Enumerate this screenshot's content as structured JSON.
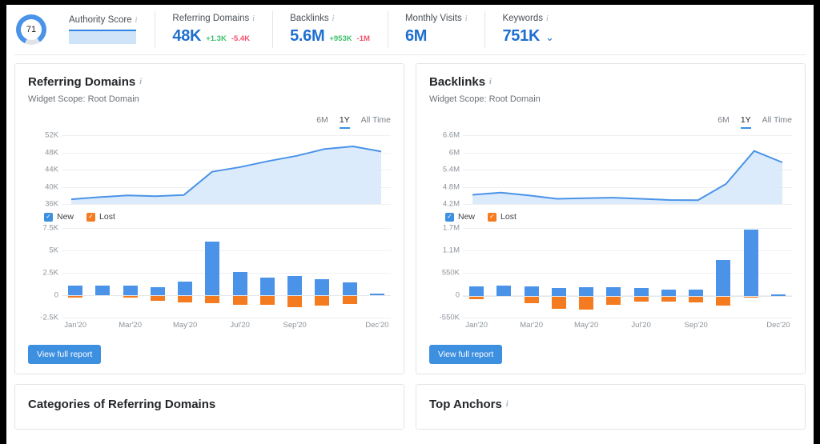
{
  "header": {
    "authority": {
      "label": "Authority Score",
      "score": "71",
      "info_icon": "info-icon"
    },
    "metrics": [
      {
        "label": "Referring Domains",
        "value": "48K",
        "up": "+1.3K",
        "down": "-5.4K"
      },
      {
        "label": "Backlinks",
        "value": "5.6M",
        "up": "+953K",
        "down": "-1M"
      },
      {
        "label": "Monthly Visits",
        "value": "6M",
        "up": "",
        "down": ""
      },
      {
        "label": "Keywords",
        "value": "751K",
        "up": "",
        "down": "",
        "caret": "⌄"
      }
    ]
  },
  "colors": {
    "blue": "#4a93e8",
    "orange": "#f47b20",
    "value_blue": "#1f6fd0",
    "up_green": "#3ec06c",
    "down_red": "#f4516c",
    "area_fill": "#d6e8fb"
  },
  "cards": [
    {
      "title": "Referring Domains",
      "subtitle": "Widget Scope: Root Domain",
      "ranges": [
        "6M",
        "1Y",
        "All Time"
      ],
      "active_range": "1Y",
      "legend": [
        {
          "label": "New",
          "color": "blue",
          "checked": true
        },
        {
          "label": "Lost",
          "color": "orange",
          "checked": true
        }
      ],
      "button": "View full report"
    },
    {
      "title": "Backlinks",
      "subtitle": "Widget Scope: Root Domain",
      "ranges": [
        "6M",
        "1Y",
        "All Time"
      ],
      "active_range": "1Y",
      "legend": [
        {
          "label": "New",
          "color": "blue",
          "checked": true
        },
        {
          "label": "Lost",
          "color": "orange",
          "checked": true
        }
      ],
      "button": "View full report"
    }
  ],
  "bottom_cards": [
    {
      "title": "Categories of Referring Domains",
      "has_info": false
    },
    {
      "title": "Top Anchors",
      "has_info": true
    }
  ],
  "chart_data": [
    {
      "type": "area",
      "title": "Referring Domains",
      "xlabel": "",
      "ylabel": "",
      "categories": [
        "Jan'20",
        "Feb'20",
        "Mar'20",
        "Apr'20",
        "May'20",
        "Jun'20",
        "Jul'20",
        "Aug'20",
        "Sep'20",
        "Oct'20",
        "Nov'20",
        "Dec'20"
      ],
      "tick_labels": [
        "Jan'20",
        "Mar'20",
        "May'20",
        "Jul'20",
        "Sep'20",
        "Dec'20"
      ],
      "yticks": [
        "36K",
        "40K",
        "44K",
        "48K",
        "52K"
      ],
      "ylim": [
        36000,
        52000
      ],
      "values": [
        37100,
        37600,
        38000,
        37800,
        38100,
        43500,
        44600,
        46000,
        47200,
        48800,
        49400,
        48200
      ],
      "grid": true,
      "legend_position": "below"
    },
    {
      "type": "bar",
      "title": "Referring Domains New / Lost",
      "categories": [
        "Jan'20",
        "Feb'20",
        "Mar'20",
        "Apr'20",
        "May'20",
        "Jun'20",
        "Jul'20",
        "Aug'20",
        "Sep'20",
        "Oct'20",
        "Nov'20",
        "Dec'20"
      ],
      "tick_labels": [
        "Jan'20",
        "Mar'20",
        "May'20",
        "Jul'20",
        "Sep'20",
        "Dec'20"
      ],
      "yticks": [
        "-2.5K",
        "0",
        "2.5K",
        "5K",
        "7.5K"
      ],
      "ylim": [
        -2500,
        7500
      ],
      "series": [
        {
          "name": "New",
          "values": [
            1100,
            1100,
            1100,
            900,
            1500,
            6000,
            2600,
            2000,
            2100,
            1800,
            1400,
            150
          ]
        },
        {
          "name": "Lost",
          "values": [
            -250,
            0,
            -250,
            -650,
            -800,
            -850,
            -1100,
            -1050,
            -1350,
            -1200,
            -950,
            0
          ]
        }
      ],
      "grid": true
    },
    {
      "type": "area",
      "title": "Backlinks",
      "categories": [
        "Jan'20",
        "Feb'20",
        "Mar'20",
        "Apr'20",
        "May'20",
        "Jun'20",
        "Jul'20",
        "Aug'20",
        "Sep'20",
        "Oct'20",
        "Nov'20",
        "Dec'20"
      ],
      "tick_labels": [
        "Jan'20",
        "Mar'20",
        "May'20",
        "Jul'20",
        "Sep'20",
        "Dec'20"
      ],
      "yticks": [
        "4.2M",
        "4.8M",
        "5.4M",
        "6M",
        "6.6M"
      ],
      "ylim": [
        4200000,
        6600000
      ],
      "values": [
        4520000,
        4600000,
        4500000,
        4380000,
        4400000,
        4420000,
        4380000,
        4340000,
        4330000,
        4900000,
        6050000,
        5650000
      ],
      "grid": true,
      "legend_position": "below"
    },
    {
      "type": "bar",
      "title": "Backlinks New / Lost",
      "categories": [
        "Jan'20",
        "Feb'20",
        "Mar'20",
        "Apr'20",
        "May'20",
        "Jun'20",
        "Jul'20",
        "Aug'20",
        "Sep'20",
        "Oct'20",
        "Nov'20",
        "Dec'20"
      ],
      "tick_labels": [
        "Jan'20",
        "Mar'20",
        "May'20",
        "Jul'20",
        "Sep'20",
        "Dec'20"
      ],
      "yticks": [
        "-550K",
        "0",
        "550K",
        "1.1M",
        "1.7M"
      ],
      "ylim": [
        -550000,
        1700000
      ],
      "series": [
        {
          "name": "New",
          "values": [
            230000,
            250000,
            230000,
            190000,
            220000,
            210000,
            200000,
            150000,
            160000,
            900000,
            1650000,
            40000
          ]
        },
        {
          "name": "Lost",
          "values": [
            -90000,
            0,
            -180000,
            -330000,
            -340000,
            -230000,
            -150000,
            -140000,
            -160000,
            -250000,
            -40000,
            0
          ]
        }
      ],
      "grid": true
    }
  ]
}
